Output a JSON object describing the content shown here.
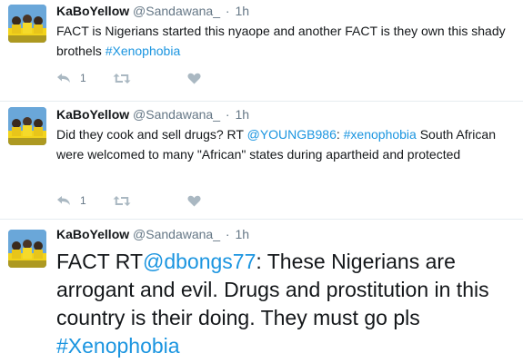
{
  "tweets": [
    {
      "name": "KaBoYellow",
      "handle": "@Sandawana_",
      "sep": "·",
      "time": "1h",
      "text_parts": [
        "FACT is Nigerians started this nyaope and another FACT is they own this shady brothels ",
        "#Xenophobia"
      ],
      "reply_count": "1"
    },
    {
      "name": "KaBoYellow",
      "handle": "@Sandawana_",
      "sep": "·",
      "time": "1h",
      "text_parts": [
        "Did they cook and sell drugs? RT ",
        "@YOUNGB986",
        ": ",
        "#xenophobia",
        " South African were welcomed to many \"African\" states during apartheid and protected"
      ],
      "reply_count": "1"
    },
    {
      "name": "KaBoYellow",
      "handle": "@Sandawana_",
      "sep": "·",
      "time": "1h",
      "text_parts": [
        "FACT RT",
        "@dbongs77",
        ": These Nigerians are arrogant and evil. Drugs and prostitution in this country is their doing. They must go pls ",
        "#Xenophobia"
      ]
    }
  ],
  "icons": {
    "reply": "reply-icon",
    "retweet": "retweet-icon",
    "like": "heart-icon"
  },
  "colors": {
    "link": "#1b95e0",
    "icon": "#aab8c2",
    "meta": "#657786",
    "avatar_bg": "#6aa7d9",
    "shirt": "#f2d31b"
  }
}
